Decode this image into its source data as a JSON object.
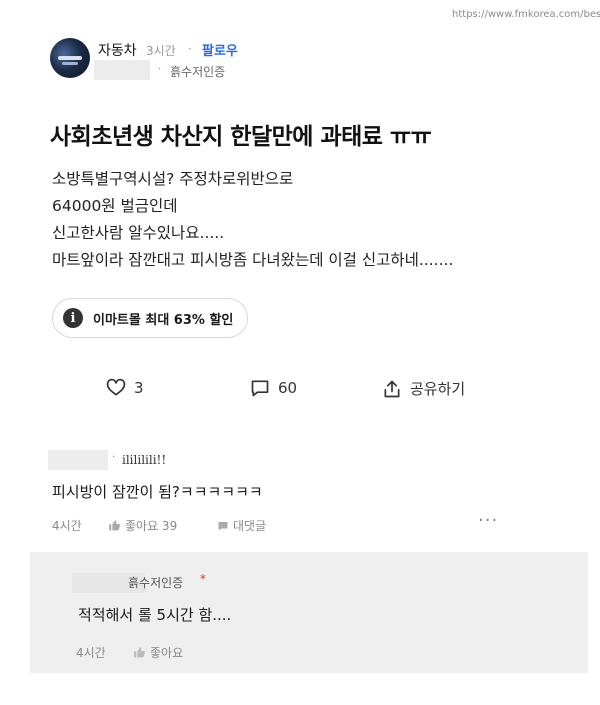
{
  "watermark": "https://www.fmkorea.com/bes",
  "post": {
    "author": "자동차",
    "time": "3시간",
    "follow_label": "팔로우",
    "verified_label": "흙수저인증",
    "title": "사회초년생 차산지 한달만에 과태료 ㅠㅠ",
    "body_lines": [
      "소방특별구역시설? 주정차로위반으로",
      "64000원 벌금인데",
      "신고한사람 알수있나요.....",
      "마트앞이라 잠깐대고 피시방좀 다녀왔는데 이걸 신고하네......."
    ],
    "ad_label": "이마트몰 최대 63% 할인",
    "likes": "3",
    "comments": "60",
    "share_label": "공유하기"
  },
  "comment": {
    "nickname": "ilililili!!",
    "text": "피시방이 잠깐이 됨?ㅋㅋㅋㅋㅋㅋ",
    "time": "4시간",
    "like_label": "좋아요 39",
    "reply_label": "대댓글",
    "more_label": "···"
  },
  "reply": {
    "verified_label": "흙수저인증",
    "author_badge": "*",
    "text": "적적해서 롤 5시간 함....",
    "time": "4시간",
    "like_label": "좋아요"
  },
  "colors": {
    "follow": "#2a6be0",
    "reply_bg": "#efefef",
    "author_badge": "#e0332e"
  }
}
